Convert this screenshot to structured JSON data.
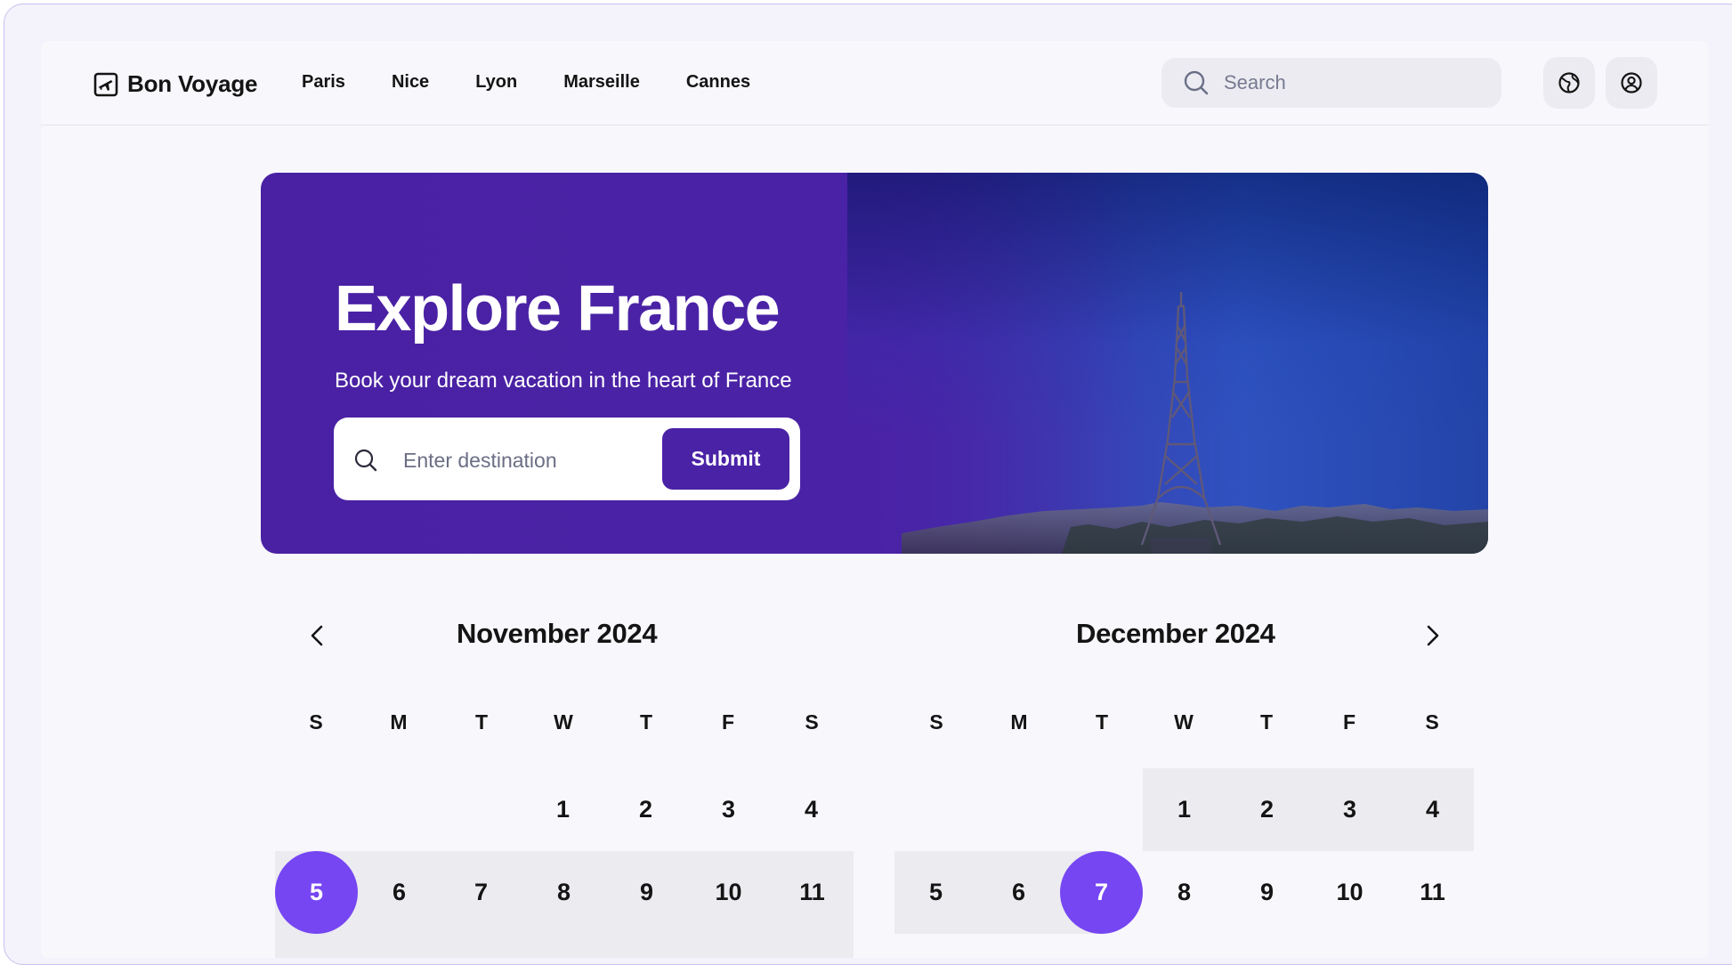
{
  "header": {
    "brand": "Bon Voyage",
    "nav": [
      "Paris",
      "Nice",
      "Lyon",
      "Marseille",
      "Cannes"
    ],
    "search_placeholder": "Search"
  },
  "hero": {
    "title": "Explore France",
    "subtitle": "Book your dream vacation in the heart of France",
    "destination_placeholder": "Enter destination",
    "submit_label": "Submit"
  },
  "calendar": {
    "weekdays": [
      "S",
      "M",
      "T",
      "W",
      "T",
      "F",
      "S"
    ],
    "months": [
      {
        "title": "November 2024",
        "rows": [
          [
            "",
            "",
            "",
            "1",
            "2",
            "3",
            "4"
          ],
          [
            "5",
            "6",
            "7",
            "8",
            "9",
            "10",
            "11"
          ]
        ]
      },
      {
        "title": "December 2024",
        "rows": [
          [
            "",
            "",
            "",
            "1",
            "2",
            "3",
            "4"
          ],
          [
            "5",
            "6",
            "7",
            "8",
            "9",
            "10",
            "11"
          ]
        ]
      }
    ],
    "selected_start": "November 5",
    "selected_end": "December 7",
    "accent_color": "#7646f2"
  },
  "colors": {
    "brand": "#4a22a6",
    "accent": "#7646f2",
    "range": "#ebebf0"
  }
}
